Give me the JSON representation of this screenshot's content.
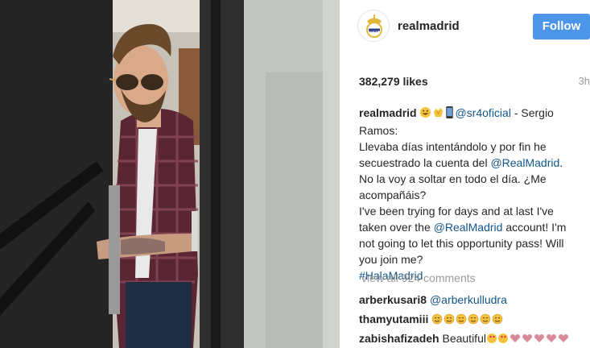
{
  "post": {
    "username": "realmadrid",
    "follow_label": "Follow",
    "likes": "382,279 likes",
    "time_ago": "3h",
    "caption": {
      "author": "realmadrid",
      "emojis_lead": [
        "grinning-face",
        "clapping-hands",
        "mobile-phone"
      ],
      "mention": "@sr4oficial",
      "after_mention": " - Sergio Ramos:",
      "line_es_1": "Llevaba días intentándolo y por fin he secuestrado la cuenta del ",
      "mention_rm_1": "@RealMadrid",
      "line_es_2": ". No la voy a soltar en todo el día. ¿Me acompañáis?",
      "line_en_1": "I've been trying for days and at last I've taken over the ",
      "mention_rm_2": "@RealMadrid",
      "line_en_2": " account! I'm not going to let this opportunity pass! Will you join me?",
      "hashtag": "#HalaMadrid"
    },
    "view_all_label": "view all 924 comments",
    "comments": [
      {
        "user": "arberkusari8",
        "text_mention": "@arberkulludra",
        "text": ""
      },
      {
        "user": "thamyutamiii",
        "text_mention": "",
        "text": "",
        "emojis": [
          "smiling-face-x6"
        ]
      },
      {
        "user": "zabishafizadeh",
        "text_mention": "",
        "text": "Beautiful",
        "emojis": [
          "heart-eyes-x2",
          "hearts-x5"
        ]
      }
    ]
  },
  "colors": {
    "follow_button": "#4c95e8",
    "link": "#125688",
    "muted": "#999999"
  }
}
